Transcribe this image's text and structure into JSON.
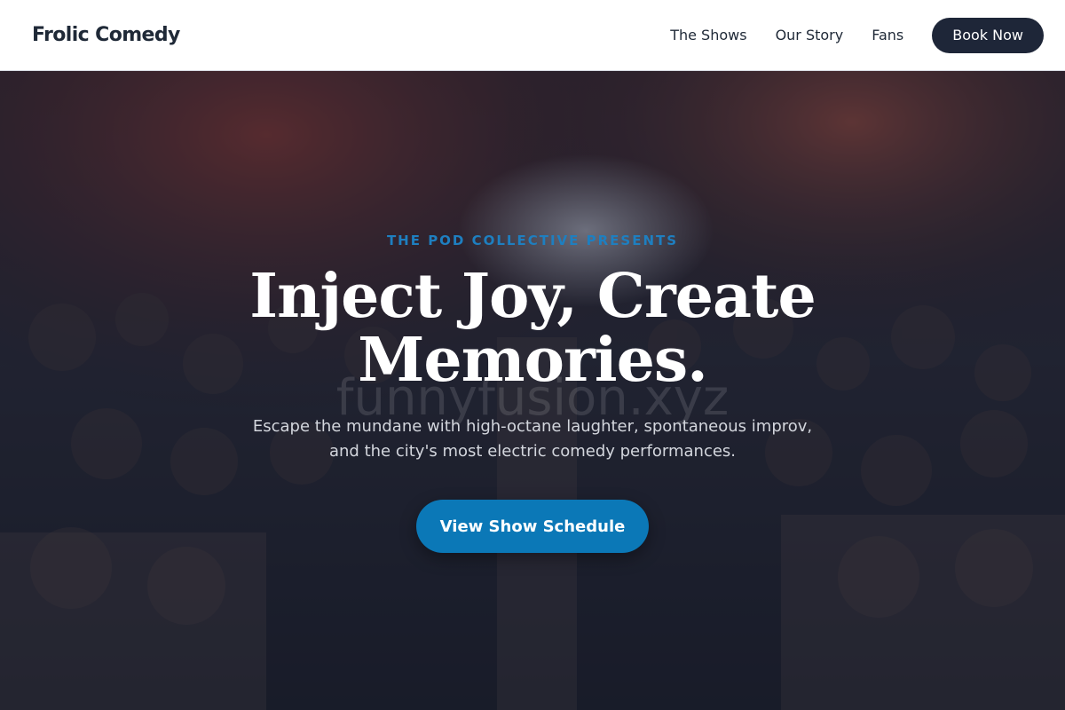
{
  "header": {
    "brand": "Frolic Comedy",
    "nav": [
      {
        "label": "The Shows"
      },
      {
        "label": "Our Story"
      },
      {
        "label": "Fans"
      }
    ],
    "cta_label": "Book Now"
  },
  "hero": {
    "eyebrow": "THE POD COLLECTIVE PRESENTS",
    "headline_line1": "Inject Joy, Create",
    "headline_line2": "Memories.",
    "watermark": "funnyfusion.xyz",
    "subtitle_line1": "Escape the mundane with high-octane laughter, spontaneous improv,",
    "subtitle_line2": "and the city's most electric comedy performances.",
    "cta_label": "View Show Schedule"
  },
  "colors": {
    "accent": "#0b78b7",
    "eyebrow": "#1e7fc0",
    "nav_button": "#1e2638",
    "overlay": "#161a28"
  }
}
